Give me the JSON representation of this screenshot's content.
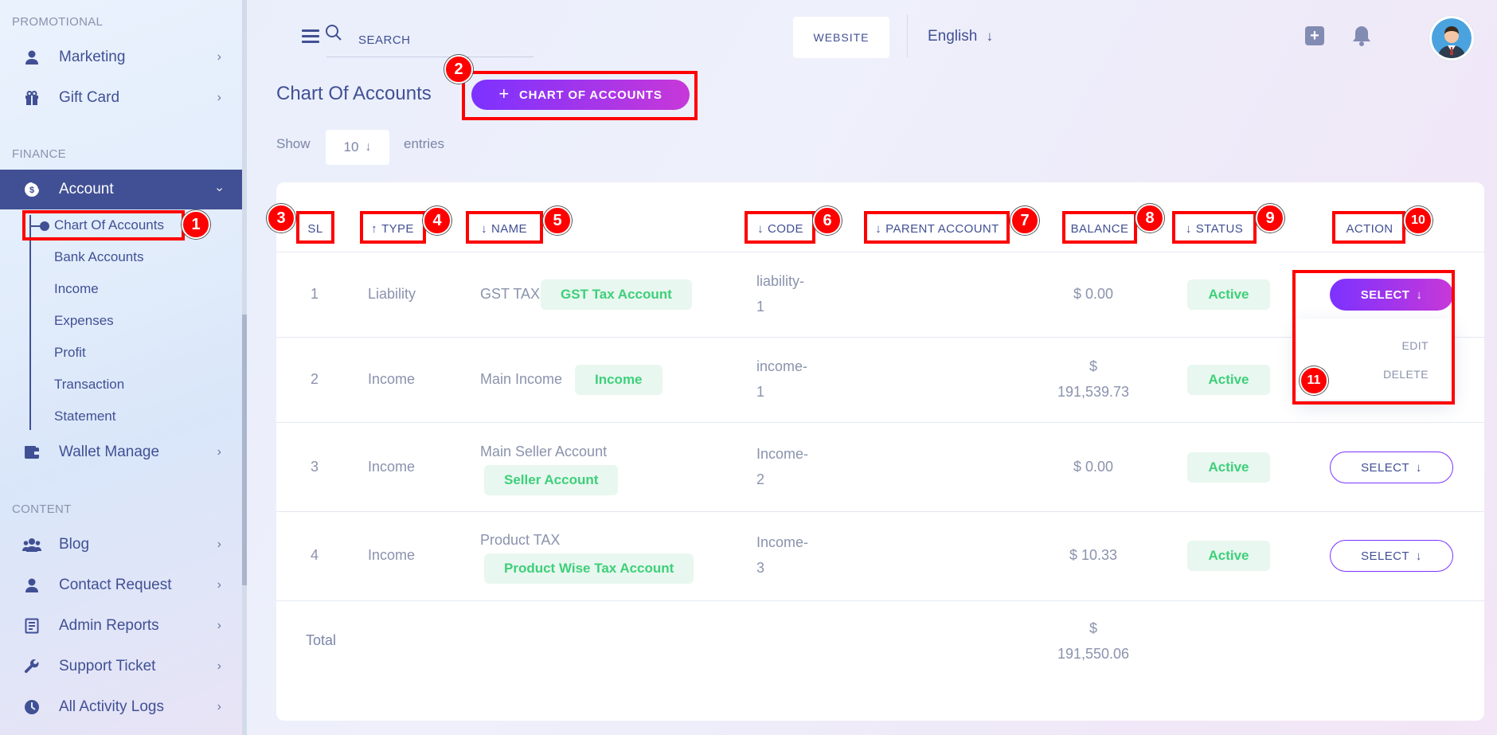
{
  "sidebar": {
    "sections": {
      "promotional": "PROMOTIONAL",
      "finance": "FINANCE",
      "content": "CONTENT"
    },
    "items": {
      "marketing": "Marketing",
      "gift_card": "Gift Card",
      "account": "Account",
      "wallet_manage": "Wallet Manage",
      "blog": "Blog",
      "contact_request": "Contact Request",
      "admin_reports": "Admin Reports",
      "support_ticket": "Support Ticket",
      "all_activity_logs": "All Activity Logs"
    },
    "account_submenu": {
      "chart_of_accounts": "Chart Of Accounts",
      "bank_accounts": "Bank Accounts",
      "income": "Income",
      "expenses": "Expenses",
      "profit": "Profit",
      "transaction": "Transaction",
      "statement": "Statement"
    }
  },
  "header": {
    "search_placeholder": "SEARCH",
    "website_label": "WEBSITE",
    "language": "English"
  },
  "page": {
    "title": "Chart Of Accounts",
    "add_button_label": "CHART OF ACCOUNTS",
    "show_label": "Show",
    "entries_value": "10",
    "entries_label": "entries"
  },
  "table": {
    "headers": {
      "sl": "SL",
      "type": "TYPE",
      "name": "NAME",
      "code": "CODE",
      "parent_account": "PARENT ACCOUNT",
      "balance": "BALANCE",
      "status": "STATUS",
      "action": "ACTION"
    },
    "rows": [
      {
        "sl": "1",
        "type": "Liability",
        "name": "GST TAX",
        "badge": "GST Tax Account",
        "code_a": "liability-",
        "code_b": "1",
        "balance_a": "$ 0.00",
        "balance_b": "",
        "status": "Active",
        "action": "SELECT"
      },
      {
        "sl": "2",
        "type": "Income",
        "name": "Main Income",
        "badge": "Income",
        "code_a": "income-",
        "code_b": "1",
        "balance_a": "$",
        "balance_b": "191,539.73",
        "status": "Active",
        "action": "SELECT"
      },
      {
        "sl": "3",
        "type": "Income",
        "name": "Main Seller Account",
        "badge": "Seller Account",
        "code_a": "Income-",
        "code_b": "2",
        "balance_a": "$ 0.00",
        "balance_b": "",
        "status": "Active",
        "action": "SELECT"
      },
      {
        "sl": "4",
        "type": "Income",
        "name": "Product TAX",
        "badge": "Product Wise Tax Account",
        "code_a": "Income-",
        "code_b": "3",
        "balance_a": "$ 10.33",
        "balance_b": "",
        "status": "Active",
        "action": "SELECT"
      }
    ],
    "total_label": "Total",
    "total_a": "$",
    "total_b": "191,550.06",
    "dropdown": {
      "edit": "EDIT",
      "delete": "DELETE"
    }
  },
  "annotations": [
    "1",
    "2",
    "3",
    "4",
    "5",
    "6",
    "7",
    "8",
    "9",
    "10",
    "11"
  ],
  "colors": {
    "primary": "#415094",
    "accent_start": "#7c32ff",
    "accent_end": "#c738d8",
    "success": "#3ecf7a",
    "annotation": "#ff0000"
  }
}
